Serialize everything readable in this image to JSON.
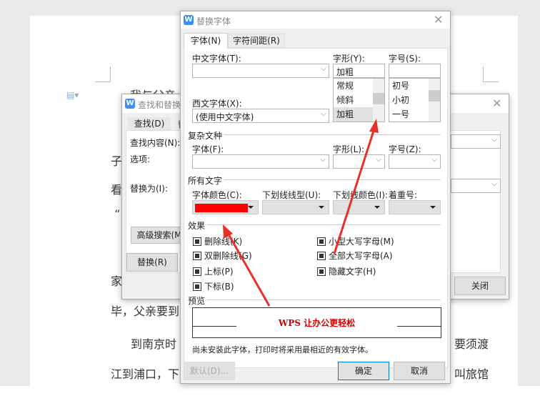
{
  "document": {
    "lines": [
      "我与父亲",
      "子",
      "看",
      "“",
      "家",
      "毕，父亲要到",
      "到南京时",
      "要须渡",
      "江到浦口，下",
      "叫旅馆"
    ]
  },
  "find_replace": {
    "title": "查找和替换",
    "tabs": [
      "查找(D)",
      "替"
    ],
    "find_label": "查找内容(N):",
    "options_label": "选项:",
    "replace_label": "替换为(I):",
    "advanced_button": "高级搜索(M",
    "replace_button": "替换(R)",
    "close_button": "关闭"
  },
  "font_dialog": {
    "title": "替换字体",
    "tabs": [
      "字体(N)",
      "字符间距(R)"
    ],
    "chinese_font_label": "中文字体(T):",
    "chinese_font_value": "",
    "style_label": "字形(Y):",
    "style_value": "加粗",
    "style_options": [
      "常规",
      "倾斜",
      "加粗"
    ],
    "size_label": "字号(S):",
    "size_value": "",
    "size_options": [
      "初号",
      "小初",
      "一号"
    ],
    "western_font_label": "西文字体(X):",
    "western_font_value": "(使用中文字体)",
    "complex_section": "复杂文种",
    "complex_font_label": "字体(F):",
    "complex_style_label": "字形(L):",
    "complex_size_label": "字号(Z):",
    "all_text_section": "所有文字",
    "font_color_label": "字体颜色(C):",
    "font_color": "#ff0000",
    "underline_type_label": "下划线线型(U):",
    "underline_color_label": "下划线颜色(I):",
    "emphasis_label": "着重号:",
    "effects_section": "效果",
    "effects_left": [
      "删除线(K)",
      "双删除线(G)",
      "上标(P)",
      "下标(B)"
    ],
    "effects_right": [
      "小型大写字母(M)",
      "全部大写字母(A)",
      "隐藏文字(H)"
    ],
    "preview_section": "预览",
    "preview_text": "WPS 让办公更轻松",
    "preview_color": "#d40000",
    "note": "尚未安装此字体，打印时将采用最相近的有效字体。",
    "default_button": "默认(D)...",
    "ok_button": "确定",
    "cancel_button": "取消"
  }
}
